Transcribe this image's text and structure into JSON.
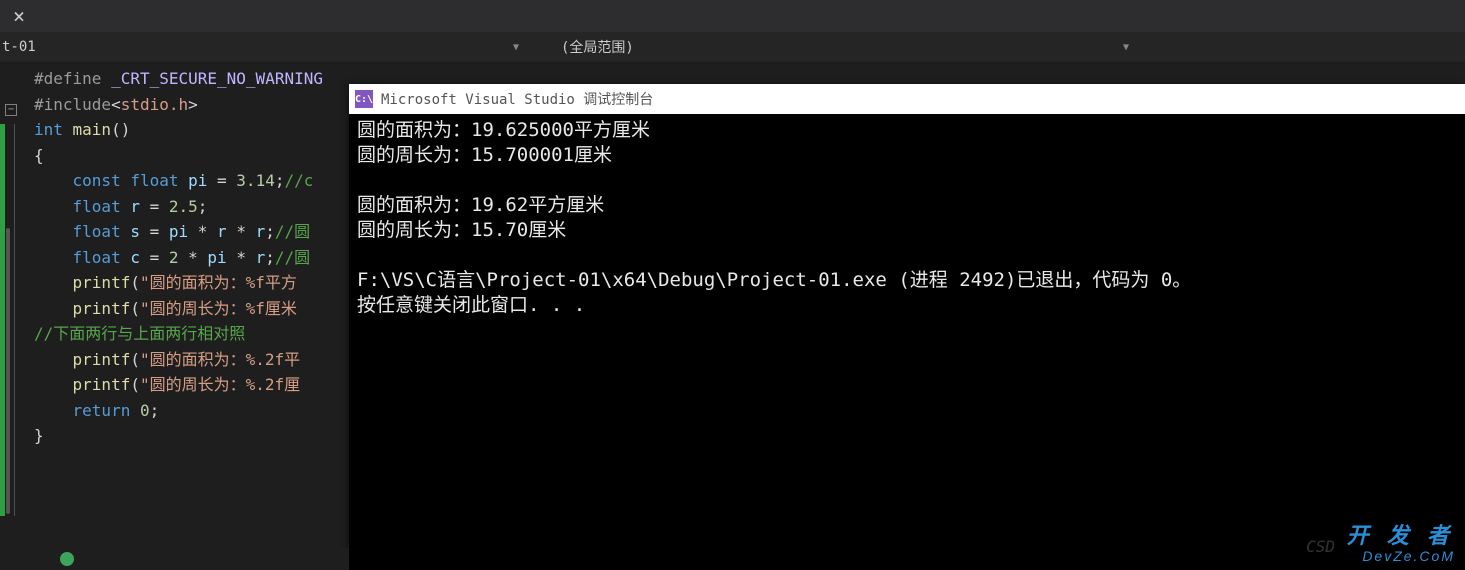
{
  "tab": {
    "close_symbol": "×"
  },
  "dropdowns": {
    "project": "t-01",
    "scope": "(全局范围)"
  },
  "code": {
    "lines": [
      {
        "raw": "#define _CRT_SECURE_NO_WARNING",
        "tokens": [
          [
            "tk-pp",
            "#define "
          ],
          [
            "tk-mac",
            "_CRT_SECURE_NO_WARNING"
          ]
        ]
      },
      {
        "raw": "#include<stdio.h>",
        "tokens": [
          [
            "tk-pp",
            "#include"
          ],
          [
            "tk-op",
            "<"
          ],
          [
            "tk-str",
            "stdio.h"
          ],
          [
            "tk-op",
            ">"
          ]
        ]
      },
      {
        "raw": "int main()",
        "tokens": [
          [
            "tk-kw",
            "int "
          ],
          [
            "tk-fn",
            "main"
          ],
          [
            "tk-op",
            "()"
          ]
        ]
      },
      {
        "raw": "{",
        "tokens": [
          [
            "tk-op",
            "{"
          ]
        ]
      },
      {
        "raw": "    const float pi = 3.14;//c",
        "tokens": [
          [
            "tk-op",
            "    "
          ],
          [
            "tk-kw",
            "const float "
          ],
          [
            "tk-id",
            "pi"
          ],
          [
            "tk-op",
            " = "
          ],
          [
            "tk-num",
            "3.14"
          ],
          [
            "tk-op",
            ";"
          ],
          [
            "tk-cm",
            "//c"
          ]
        ]
      },
      {
        "raw": "    float r = 2.5;",
        "tokens": [
          [
            "tk-op",
            "    "
          ],
          [
            "tk-kw",
            "float "
          ],
          [
            "tk-id",
            "r"
          ],
          [
            "tk-op",
            " = "
          ],
          [
            "tk-num",
            "2.5"
          ],
          [
            "tk-op",
            ";"
          ]
        ]
      },
      {
        "raw": "    float s = pi * r * r;//圆",
        "tokens": [
          [
            "tk-op",
            "    "
          ],
          [
            "tk-kw",
            "float "
          ],
          [
            "tk-id",
            "s"
          ],
          [
            "tk-op",
            " = "
          ],
          [
            "tk-id",
            "pi"
          ],
          [
            "tk-op",
            " * "
          ],
          [
            "tk-id",
            "r"
          ],
          [
            "tk-op",
            " * "
          ],
          [
            "tk-id",
            "r"
          ],
          [
            "tk-op",
            ";"
          ],
          [
            "tk-cm",
            "//圆"
          ]
        ]
      },
      {
        "raw": "    float c = 2 * pi * r;//圆",
        "tokens": [
          [
            "tk-op",
            "    "
          ],
          [
            "tk-kw",
            "float "
          ],
          [
            "tk-id",
            "c"
          ],
          [
            "tk-op",
            " = "
          ],
          [
            "tk-num",
            "2"
          ],
          [
            "tk-op",
            " * "
          ],
          [
            "tk-id",
            "pi"
          ],
          [
            "tk-op",
            " * "
          ],
          [
            "tk-id",
            "r"
          ],
          [
            "tk-op",
            ";"
          ],
          [
            "tk-cm",
            "//圆"
          ]
        ]
      },
      {
        "raw": "    printf(\"圆的面积为：%f平方",
        "tokens": [
          [
            "tk-op",
            "    "
          ],
          [
            "tk-fn",
            "printf"
          ],
          [
            "tk-op",
            "("
          ],
          [
            "tk-str",
            "\"圆的面积为：%f平方"
          ]
        ]
      },
      {
        "raw": "    printf(\"圆的周长为：%f厘米",
        "tokens": [
          [
            "tk-op",
            "    "
          ],
          [
            "tk-fn",
            "printf"
          ],
          [
            "tk-op",
            "("
          ],
          [
            "tk-str",
            "\"圆的周长为：%f厘米"
          ]
        ]
      },
      {
        "raw": "//下面两行与上面两行相对照",
        "tokens": [
          [
            "tk-cm",
            "//下面两行与上面两行相对照"
          ]
        ]
      },
      {
        "raw": "    printf(\"圆的面积为：%.2f平",
        "tokens": [
          [
            "tk-op",
            "    "
          ],
          [
            "tk-fn",
            "printf"
          ],
          [
            "tk-op",
            "("
          ],
          [
            "tk-str",
            "\"圆的面积为：%.2f平"
          ]
        ]
      },
      {
        "raw": "    printf(\"圆的周长为：%.2f厘",
        "tokens": [
          [
            "tk-op",
            "    "
          ],
          [
            "tk-fn",
            "printf"
          ],
          [
            "tk-op",
            "("
          ],
          [
            "tk-str",
            "\"圆的周长为：%.2f厘"
          ]
        ]
      },
      {
        "raw": "    return 0;",
        "tokens": [
          [
            "tk-op",
            "    "
          ],
          [
            "tk-kw",
            "return "
          ],
          [
            "tk-num",
            "0"
          ],
          [
            "tk-op",
            ";"
          ]
        ]
      },
      {
        "raw": "}",
        "tokens": [
          [
            "tk-op",
            "}"
          ]
        ]
      }
    ]
  },
  "fold": {
    "symbol": "−"
  },
  "console": {
    "title": "Microsoft Visual Studio 调试控制台",
    "icon_text": "C:\\",
    "lines": [
      "圆的面积为：19.625000平方厘米",
      "圆的周长为：15.700001厘米",
      "",
      "圆的面积为：19.62平方厘米",
      "圆的周长为：15.70厘米",
      "",
      "F:\\VS\\C语言\\Project-01\\x64\\Debug\\Project-01.exe (进程 2492)已退出，代码为 0。",
      "按任意键关闭此窗口. . ."
    ]
  },
  "watermark": {
    "main": "开 发 者",
    "sub": "DevZe.CoM",
    "csdn": "CSD"
  }
}
